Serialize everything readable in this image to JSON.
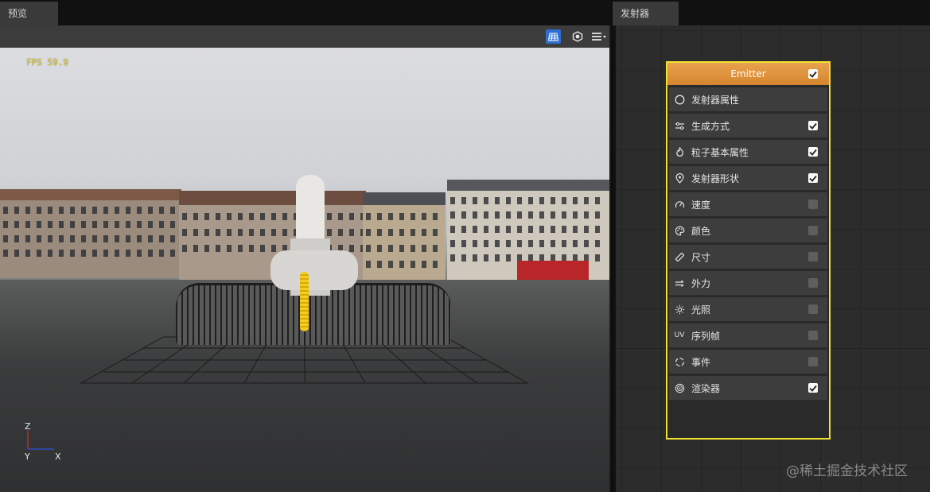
{
  "preview": {
    "tab_label": "预览",
    "fps": "FPS 59.9",
    "toolbar": {
      "grid_icon": "grid-icon",
      "camera_icon": "camera-icon",
      "menu_icon": "menu-icon"
    },
    "axes": {
      "z": "Z",
      "y": "Y",
      "x": "X"
    }
  },
  "emitter_panel": {
    "tab_label": "发射器",
    "node": {
      "title": "Emitter",
      "enabled": true,
      "modules": [
        {
          "label": "发射器属性",
          "icon": "circle-icon",
          "checkbox": null
        },
        {
          "label": "生成方式",
          "icon": "sliders-icon",
          "checkbox": true
        },
        {
          "label": "粒子基本属性",
          "icon": "flame-icon",
          "checkbox": true
        },
        {
          "label": "发射器形状",
          "icon": "location-pin-icon",
          "checkbox": true
        },
        {
          "label": "速度",
          "icon": "speedometer-icon",
          "checkbox": false
        },
        {
          "label": "颜色",
          "icon": "palette-icon",
          "checkbox": false
        },
        {
          "label": "尺寸",
          "icon": "ruler-icon",
          "checkbox": false
        },
        {
          "label": "外力",
          "icon": "arrows-right-icon",
          "checkbox": false
        },
        {
          "label": "光照",
          "icon": "sun-icon",
          "checkbox": false
        },
        {
          "label": "序列帧",
          "icon": "uv-icon",
          "checkbox": false
        },
        {
          "label": "事件",
          "icon": "refresh-icon",
          "checkbox": false
        },
        {
          "label": "渲染器",
          "icon": "render-icon",
          "checkbox": true
        }
      ]
    }
  },
  "watermark": "@稀土掘金技术社区",
  "colors": {
    "node_border": "#f0e130",
    "node_header": "#e19a45",
    "toolbar_active": "#2f6fd1",
    "fps_text": "#f2e23a"
  }
}
